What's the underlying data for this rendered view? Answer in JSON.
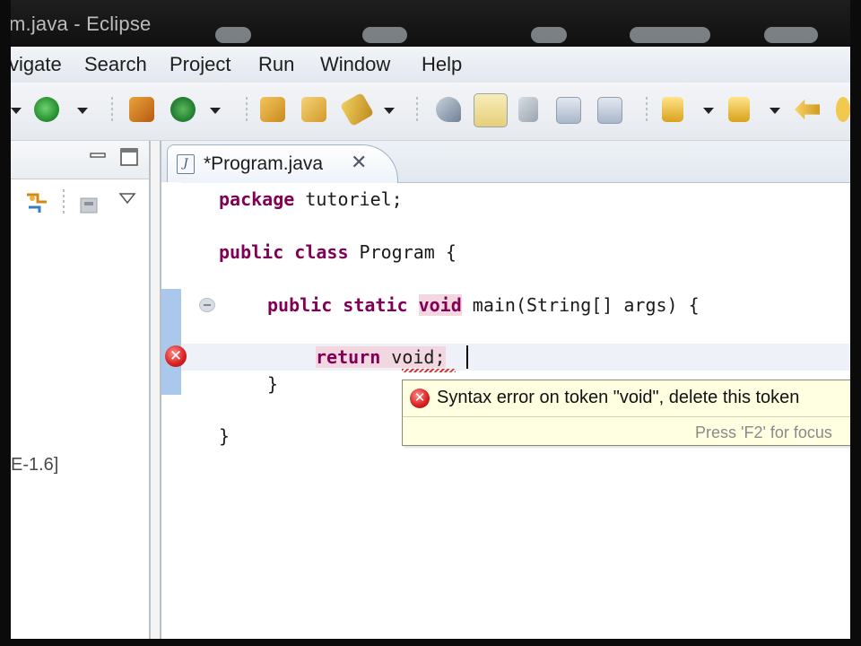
{
  "window": {
    "title": "m.java - Eclipse"
  },
  "menu": {
    "items": [
      "vigate",
      "Search",
      "Project",
      "Run",
      "Window",
      "Help"
    ]
  },
  "left_panel": {
    "library_label": "E-1.6]"
  },
  "editor": {
    "tab_label": "*Program.java",
    "tab_close": "✕",
    "code": {
      "line1": {
        "kw": "package",
        "rest": " tutoriel;"
      },
      "line2": {
        "kw1": "public",
        "kw2": "class",
        "rest": " Program {"
      },
      "line3": {
        "kw1": "public",
        "kw2": "static",
        "kw3": "void",
        "rest": " main(String[] args) {"
      },
      "line4": {
        "kw": "return",
        "rest": " void;"
      },
      "line5": "}",
      "line6": "}"
    }
  },
  "tooltip": {
    "message": "Syntax error on token \"void\", delete this token",
    "hint": "Press 'F2' for focus"
  },
  "colors": {
    "keyword": "#7f0055",
    "error": "#d61f1f",
    "tooltip_bg": "#ffffe1",
    "change_bar": "#a9c8ec"
  }
}
